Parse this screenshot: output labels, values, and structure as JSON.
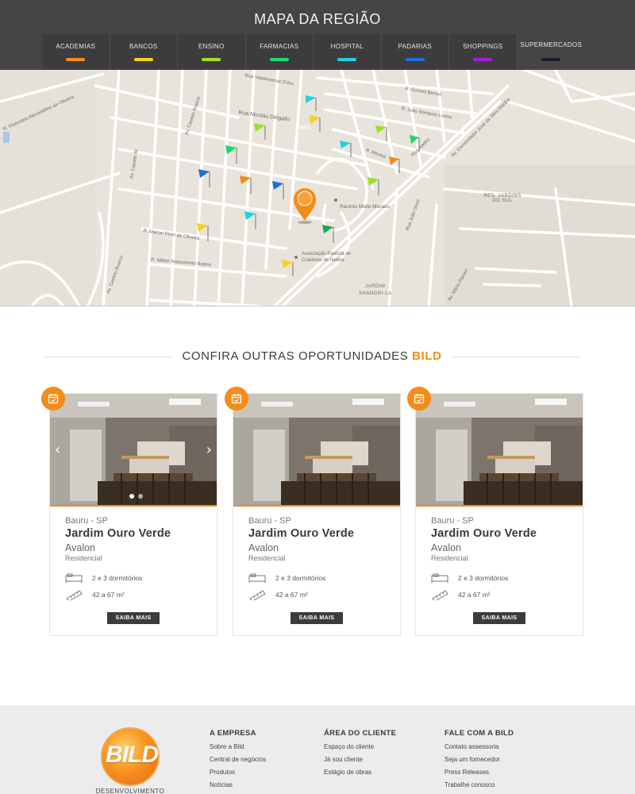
{
  "header": {
    "title": "MAPA DA REGIÃO",
    "tabs": [
      {
        "label": "ACADEMIAS",
        "color": "#f28c1b"
      },
      {
        "label": "BANCOS",
        "color": "#f5d31c"
      },
      {
        "label": "ENSINO",
        "color": "#9ee023"
      },
      {
        "label": "FARMACIAS",
        "color": "#1cd96b"
      },
      {
        "label": "HOSPITAL",
        "color": "#1fd3e0"
      },
      {
        "label": "PADARIAS",
        "color": "#1d6fdc"
      },
      {
        "label": "SHOPPINGS",
        "color": "#a31fdc"
      },
      {
        "label": "SUPERMERCADOS",
        "color": "#1c1c2a"
      }
    ]
  },
  "map": {
    "labels": {
      "florentino": "R. Florentino Alexandrino de Oliveira",
      "valderramas": "Rua Valderramas D'Arc",
      "castelo1": "Av. Castelo Branco",
      "castelo2": "Av. Castelo Br.",
      "castelo3": "Av. Castelo Branco",
      "nicolau": "Rua Nicolau Delgallo",
      "gomes": "R. Gomes Berriel",
      "joao_marques": "R. João Marques Lontra",
      "comendador": "Av. Comendador José da Silva Martha",
      "alaska": "Rua Alaska",
      "mexico": "R. México",
      "res_jardins": "RES. JARDINS DO SUL",
      "recinto": "Recinto Mello Moraes",
      "assoc1": "Associação Paulista de",
      "assoc2": "Criadores de Nelore",
      "jardim1": "JARDIM",
      "jardim2": "SHANGRI-LA",
      "marcel": "R. Marcel Pinto de Oliveira",
      "milton": "R. Milton Nascimento Bueno",
      "joao_grice": "Rua João Grice",
      "mario": "Av. Mário Ranieri"
    },
    "brand_marker": "BILD"
  },
  "section": {
    "title_prefix": "CONFIRA OUTRAS OPORTUNIDADES",
    "title_accent": "BILD"
  },
  "cards": [
    {
      "city": "Bauru - SP",
      "name": "Jardim Ouro Verde",
      "sub": "Avalon",
      "type": "Residencial",
      "rooms": "2 e 3 dormitórios",
      "area": "42 a 67 m²",
      "button": "SAIBA MAIS"
    },
    {
      "city": "Bauru - SP",
      "name": "Jardim Ouro Verde",
      "sub": "Avalon",
      "type": "Residencial",
      "rooms": "2 e 3 dormitórios",
      "area": "42 a 67 m²",
      "button": "SAIBA MAIS"
    },
    {
      "city": "Bauru - SP",
      "name": "Jardim Ouro Verde",
      "sub": "Avalon",
      "type": "Residencial",
      "rooms": "2 e 3 dormitórios",
      "area": "42 a 67 m²",
      "button": "SAIBA MAIS"
    }
  ],
  "footer": {
    "logo_text": "BILD",
    "logo_sub": "DESENVOLVIMENTO",
    "columns": [
      {
        "heading": "A EMPRESA",
        "items": [
          "Sobre a Bild",
          "Central de negócios",
          "Produtos",
          "Notícias"
        ]
      },
      {
        "heading": "ÁREA DO CLIENTE",
        "items": [
          "Espaço do cliente",
          "Já sou cliente",
          "Estágio de obras"
        ]
      },
      {
        "heading": "FALE COM A BILD",
        "items": [
          "Contato assessoria",
          "Seja um fornecedor",
          "Press Releases",
          "Trabalhe conosco"
        ]
      }
    ]
  },
  "colors": {
    "accent": "#f28c1b",
    "dark": "#3c3c3c"
  }
}
